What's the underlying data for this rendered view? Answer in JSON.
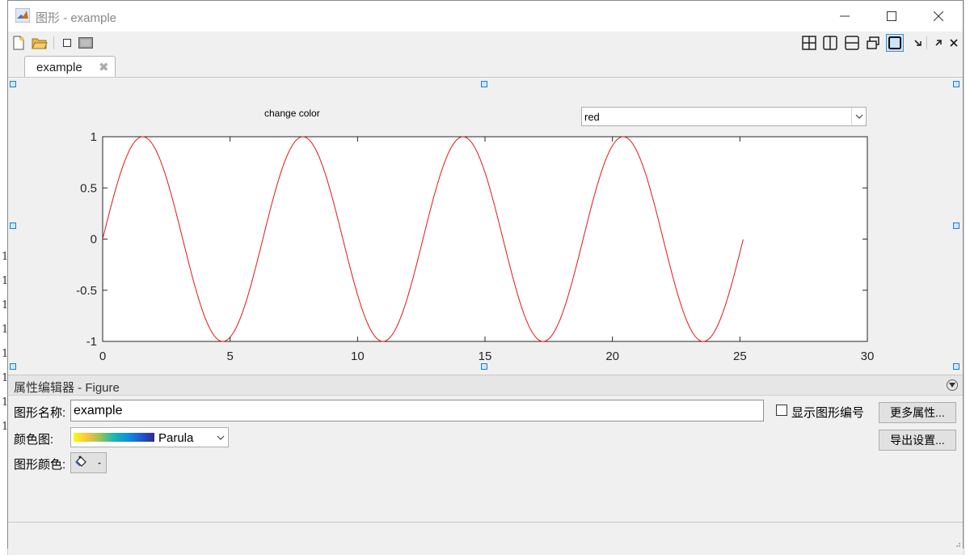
{
  "window": {
    "title": "图形 - example"
  },
  "tab": {
    "label": "example"
  },
  "canvas": {
    "label_text": "change color",
    "popup_value": "red",
    "line_color": "#e81414"
  },
  "chart_data": {
    "type": "line",
    "function": "sin(x)",
    "x_range_data": [
      0,
      25.13
    ],
    "xlim": [
      0,
      30
    ],
    "ylim": [
      -1,
      1
    ],
    "xticks": [
      0,
      5,
      10,
      15,
      20,
      25,
      30
    ],
    "yticks": [
      1,
      0.5,
      0,
      -0.5,
      -1
    ],
    "series": [
      {
        "color": "#e81414",
        "samples_note_free": true
      }
    ]
  },
  "property_editor": {
    "title": "属性编辑器 - Figure",
    "figure_name_label": "图形名称:",
    "figure_name_value": "example",
    "show_number_label": "显示图形编号",
    "more_props_button": "更多属性...",
    "colormap_label": "颜色图:",
    "colormap_value": "Parula",
    "export_button": "导出设置...",
    "figure_color_label": "图形颜色:"
  },
  "icons": [
    "matlab-icon",
    "new-figure-icon",
    "open-icon",
    "dock-icon",
    "undock-icon",
    "tile-grid-icon",
    "tile-columns-icon",
    "tile-rows-icon",
    "float-icon",
    "maximize-icon",
    "minimize-panel-icon",
    "undock-panel-icon",
    "close-panel-icon"
  ],
  "left_strip_digits": [
    "1",
    "1",
    "1",
    "1",
    "1",
    "1",
    "1",
    "1"
  ]
}
